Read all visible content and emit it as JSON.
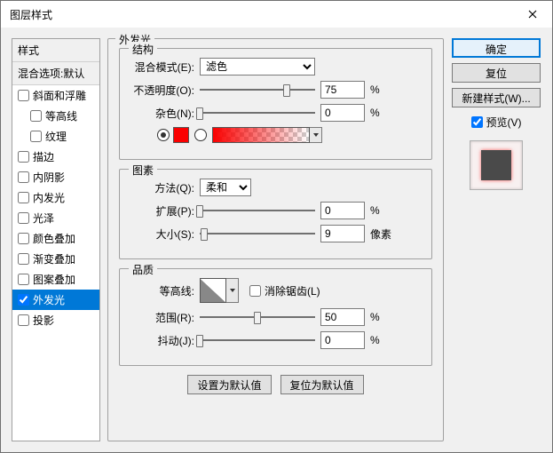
{
  "title": "图层样式",
  "left": {
    "header": "样式",
    "blendHeader": "混合选项:默认",
    "items": [
      {
        "label": "斜面和浮雕",
        "checked": false,
        "indent": false,
        "selected": false
      },
      {
        "label": "等高线",
        "checked": false,
        "indent": true,
        "selected": false
      },
      {
        "label": "纹理",
        "checked": false,
        "indent": true,
        "selected": false
      },
      {
        "label": "描边",
        "checked": false,
        "indent": false,
        "selected": false
      },
      {
        "label": "内阴影",
        "checked": false,
        "indent": false,
        "selected": false
      },
      {
        "label": "内发光",
        "checked": false,
        "indent": false,
        "selected": false
      },
      {
        "label": "光泽",
        "checked": false,
        "indent": false,
        "selected": false
      },
      {
        "label": "颜色叠加",
        "checked": false,
        "indent": false,
        "selected": false
      },
      {
        "label": "渐变叠加",
        "checked": false,
        "indent": false,
        "selected": false
      },
      {
        "label": "图案叠加",
        "checked": false,
        "indent": false,
        "selected": false
      },
      {
        "label": "外发光",
        "checked": true,
        "indent": false,
        "selected": true
      },
      {
        "label": "投影",
        "checked": false,
        "indent": false,
        "selected": false
      }
    ]
  },
  "outerGlow": {
    "title": "外发光",
    "structure": {
      "title": "结构",
      "blendModeLabel": "混合模式(E):",
      "blendModeValue": "滤色",
      "opacityLabel": "不透明度(O):",
      "opacityValue": "75",
      "opacityUnit": "%",
      "opacityPct": 75,
      "noiseLabel": "杂色(N):",
      "noiseValue": "0",
      "noiseUnit": "%",
      "noisePct": 0,
      "color": "#fa0000"
    },
    "elements": {
      "title": "图素",
      "techniqueLabel": "方法(Q):",
      "techniqueValue": "柔和",
      "spreadLabel": "扩展(P):",
      "spreadValue": "0",
      "spreadUnit": "%",
      "spreadPct": 0,
      "sizeLabel": "大小(S):",
      "sizeValue": "9",
      "sizeUnit": "像素",
      "sizePct": 4
    },
    "quality": {
      "title": "品质",
      "contourLabel": "等高线:",
      "antiAliasLabel": "消除锯齿(L)",
      "antiAliasChecked": false,
      "rangeLabel": "范围(R):",
      "rangeValue": "50",
      "rangeUnit": "%",
      "rangePct": 50,
      "jitterLabel": "抖动(J):",
      "jitterValue": "0",
      "jitterUnit": "%",
      "jitterPct": 0
    },
    "buttons": {
      "setDefault": "设置为默认值",
      "resetDefault": "复位为默认值"
    }
  },
  "right": {
    "ok": "确定",
    "reset": "复位",
    "newStyle": "新建样式(W)...",
    "previewLabel": "预览(V)",
    "previewChecked": true
  }
}
